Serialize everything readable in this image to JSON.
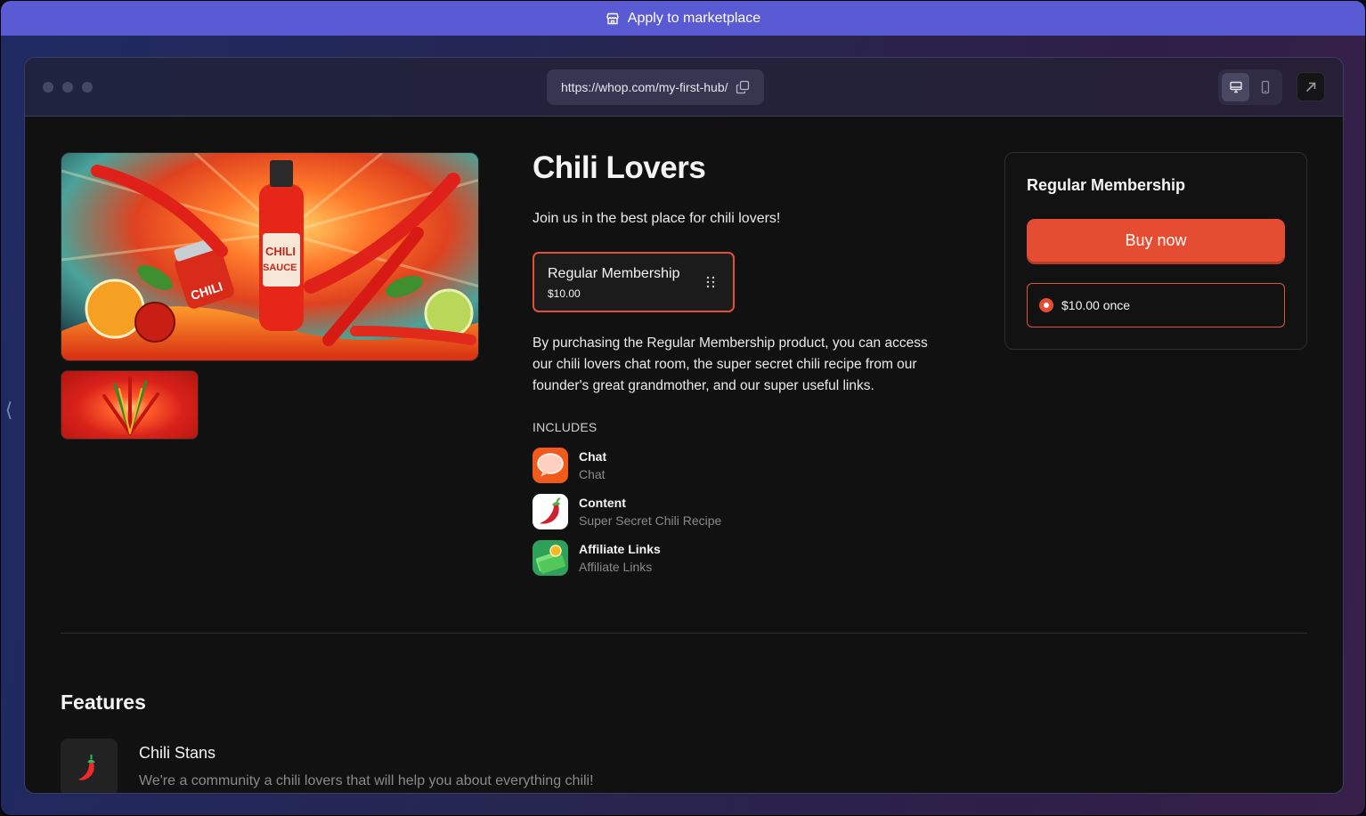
{
  "banner": {
    "label": "Apply to marketplace",
    "icon": "storefront-icon",
    "color": "#5a5bd4"
  },
  "browser": {
    "url": "https://whop.com/my-first-hub/",
    "copy_icon": "copy-icon",
    "view_modes": [
      {
        "name": "desktop",
        "icon": "monitor-icon",
        "active": true
      },
      {
        "name": "mobile",
        "icon": "phone-icon",
        "active": false
      }
    ],
    "open_icon": "arrow-up-right-icon"
  },
  "product": {
    "title": "Chili Lovers",
    "tagline": "Join us in the best place for chili lovers!",
    "gallery": [
      {
        "alt": "Chili sauce illustration",
        "labels": [
          "CHILI SAUCE",
          "CHILI SAUCE"
        ]
      },
      {
        "alt": "Chili burst thumbnail"
      }
    ],
    "plan": {
      "name": "Regular Membership",
      "price": "$10.00"
    },
    "description": "By purchasing the Regular Membership product, you can access our chili lovers chat room, the super secret chili recipe from our founder's great grandmother, and our super useful links.",
    "includes_label": "INCLUDES",
    "includes": [
      {
        "title": "Chat",
        "subtitle": "Chat",
        "icon": "chat-bubble-icon"
      },
      {
        "title": "Content",
        "subtitle": "Super Secret Chili Recipe",
        "icon": "chili-pepper-icon"
      },
      {
        "title": "Affiliate Links",
        "subtitle": "Affiliate Links",
        "icon": "money-stack-icon"
      }
    ]
  },
  "checkout": {
    "title": "Regular Membership",
    "buy_label": "Buy now",
    "price_option": "$10.00 once",
    "accent": "#e44d31"
  },
  "features": {
    "heading": "Features",
    "items": [
      {
        "title": "Chili Stans",
        "description": "We're a community a chili lovers that will help you about everything chili!",
        "icon": "chili-pepper-icon"
      }
    ]
  },
  "sidebar_toggle": {
    "icon": "chevron-left-icon",
    "glyph": "⟨"
  }
}
